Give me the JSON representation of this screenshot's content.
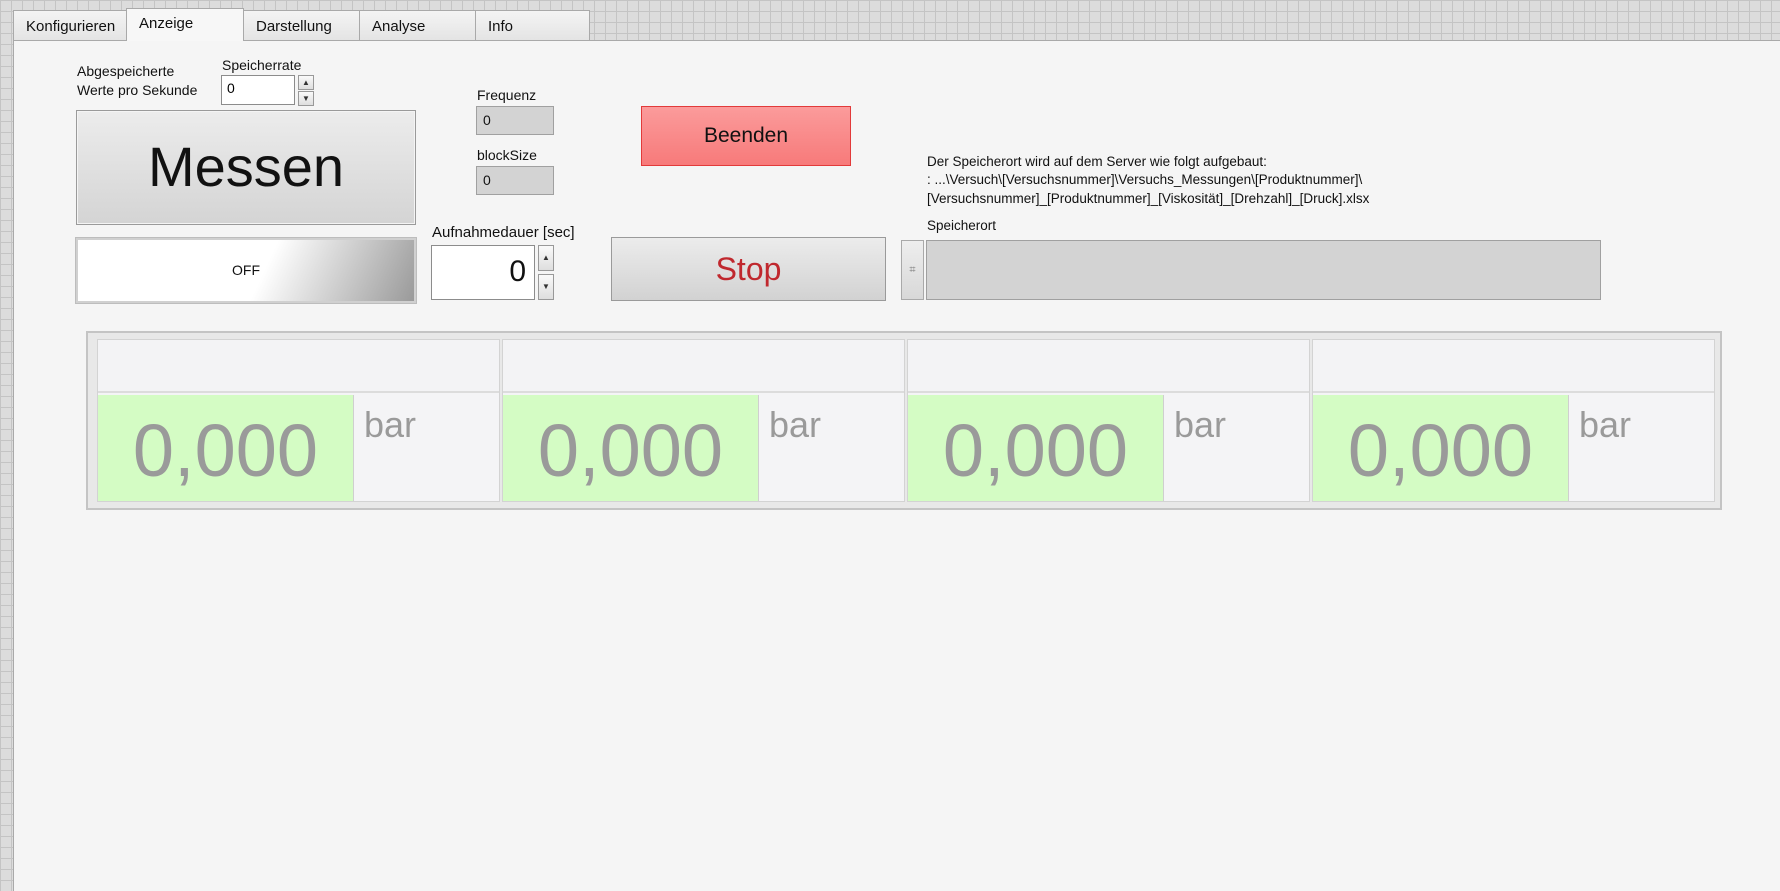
{
  "tabs": [
    "Konfigurieren",
    "Anzeige",
    "Darstellung",
    "Analyse",
    "Info"
  ],
  "active_tab": "Anzeige",
  "controls": {
    "saved_values_label_line1": "Abgespeicherte",
    "saved_values_label_line2": "Werte pro Sekunde",
    "save_rate_label": "Speicherrate",
    "save_rate_value": "0",
    "measure_button": "Messen",
    "toggle_state": "OFF",
    "frequency_label": "Frequenz",
    "frequency_value": "0",
    "blocksize_label": "blockSize",
    "blocksize_value": "0",
    "duration_label": "Aufnahmedauer [sec]",
    "duration_value": "0",
    "quit_button": "Beenden",
    "stop_button": "Stop"
  },
  "storage": {
    "info_line1": "Der Speicherort wird auf dem Server wie folgt aufgebaut:",
    "info_line2": ": ...\\Versuch\\[Versuchsnummer]\\Versuchs_Messungen\\[Produktnummer]\\",
    "info_line3": "[Versuchsnummer]_[Produktnummer]_[Viskosität]_[Drehzahl]_[Druck].xlsx",
    "path_label": "Speicherort",
    "path_value": ""
  },
  "gauges": [
    {
      "title": "",
      "value": "0,000",
      "unit": "bar"
    },
    {
      "title": "",
      "value": "0,000",
      "unit": "bar"
    },
    {
      "title": "",
      "value": "0,000",
      "unit": "bar"
    },
    {
      "title": "",
      "value": "0,000",
      "unit": "bar"
    }
  ],
  "colors": {
    "value_background": "#d4fcc4",
    "quit_button": "#f77a7a",
    "stop_text": "#c0282e"
  }
}
